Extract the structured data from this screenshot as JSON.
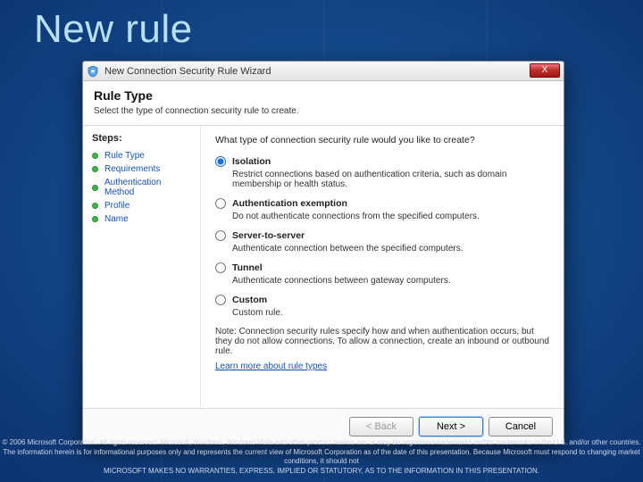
{
  "slide": {
    "title": "New rule"
  },
  "wizard": {
    "window_title": "New Connection Security Rule Wizard",
    "close_glyph": "X",
    "header": {
      "title": "Rule Type",
      "subtitle": "Select the type of connection security rule to create."
    },
    "steps_title": "Steps:",
    "steps": [
      {
        "label": "Rule Type"
      },
      {
        "label": "Requirements"
      },
      {
        "label": "Authentication Method"
      },
      {
        "label": "Profile"
      },
      {
        "label": "Name"
      }
    ],
    "prompt": "What type of connection security rule would you like to create?",
    "options": [
      {
        "key": "isolation",
        "title": "Isolation",
        "desc": "Restrict connections based on authentication criteria, such as domain membership or health status.",
        "selected": true
      },
      {
        "key": "auth-exemption",
        "title": "Authentication exemption",
        "desc": "Do not authenticate connections from the specified computers.",
        "selected": false
      },
      {
        "key": "server-to-server",
        "title": "Server-to-server",
        "desc": "Authenticate connection between the specified computers.",
        "selected": false
      },
      {
        "key": "tunnel",
        "title": "Tunnel",
        "desc": "Authenticate connections between gateway computers.",
        "selected": false
      },
      {
        "key": "custom",
        "title": "Custom",
        "desc": "Custom rule.",
        "selected": false
      }
    ],
    "note": "Note: Connection security rules specify how and when authentication occurs, but they do not allow connections. To allow a connection, create an inbound or outbound rule.",
    "learn_more": "Learn more about rule types",
    "buttons": {
      "back": "< Back",
      "next": "Next >",
      "cancel": "Cancel"
    }
  },
  "footer": {
    "line1": "© 2006 Microsoft Corporation. All rights reserved. Microsoft, Windows, Windows Vista and other product names are or may be registered trademarks and/or trademarks in the U.S. and/or other countries.",
    "line2": "The information herein is for informational purposes only and represents the current view of Microsoft Corporation as of the date of this presentation. Because Microsoft must respond to changing market conditions, it should not",
    "line3": "MICROSOFT MAKES NO WARRANTIES, EXPRESS, IMPLIED OR STATUTORY, AS TO THE INFORMATION IN THIS PRESENTATION."
  }
}
